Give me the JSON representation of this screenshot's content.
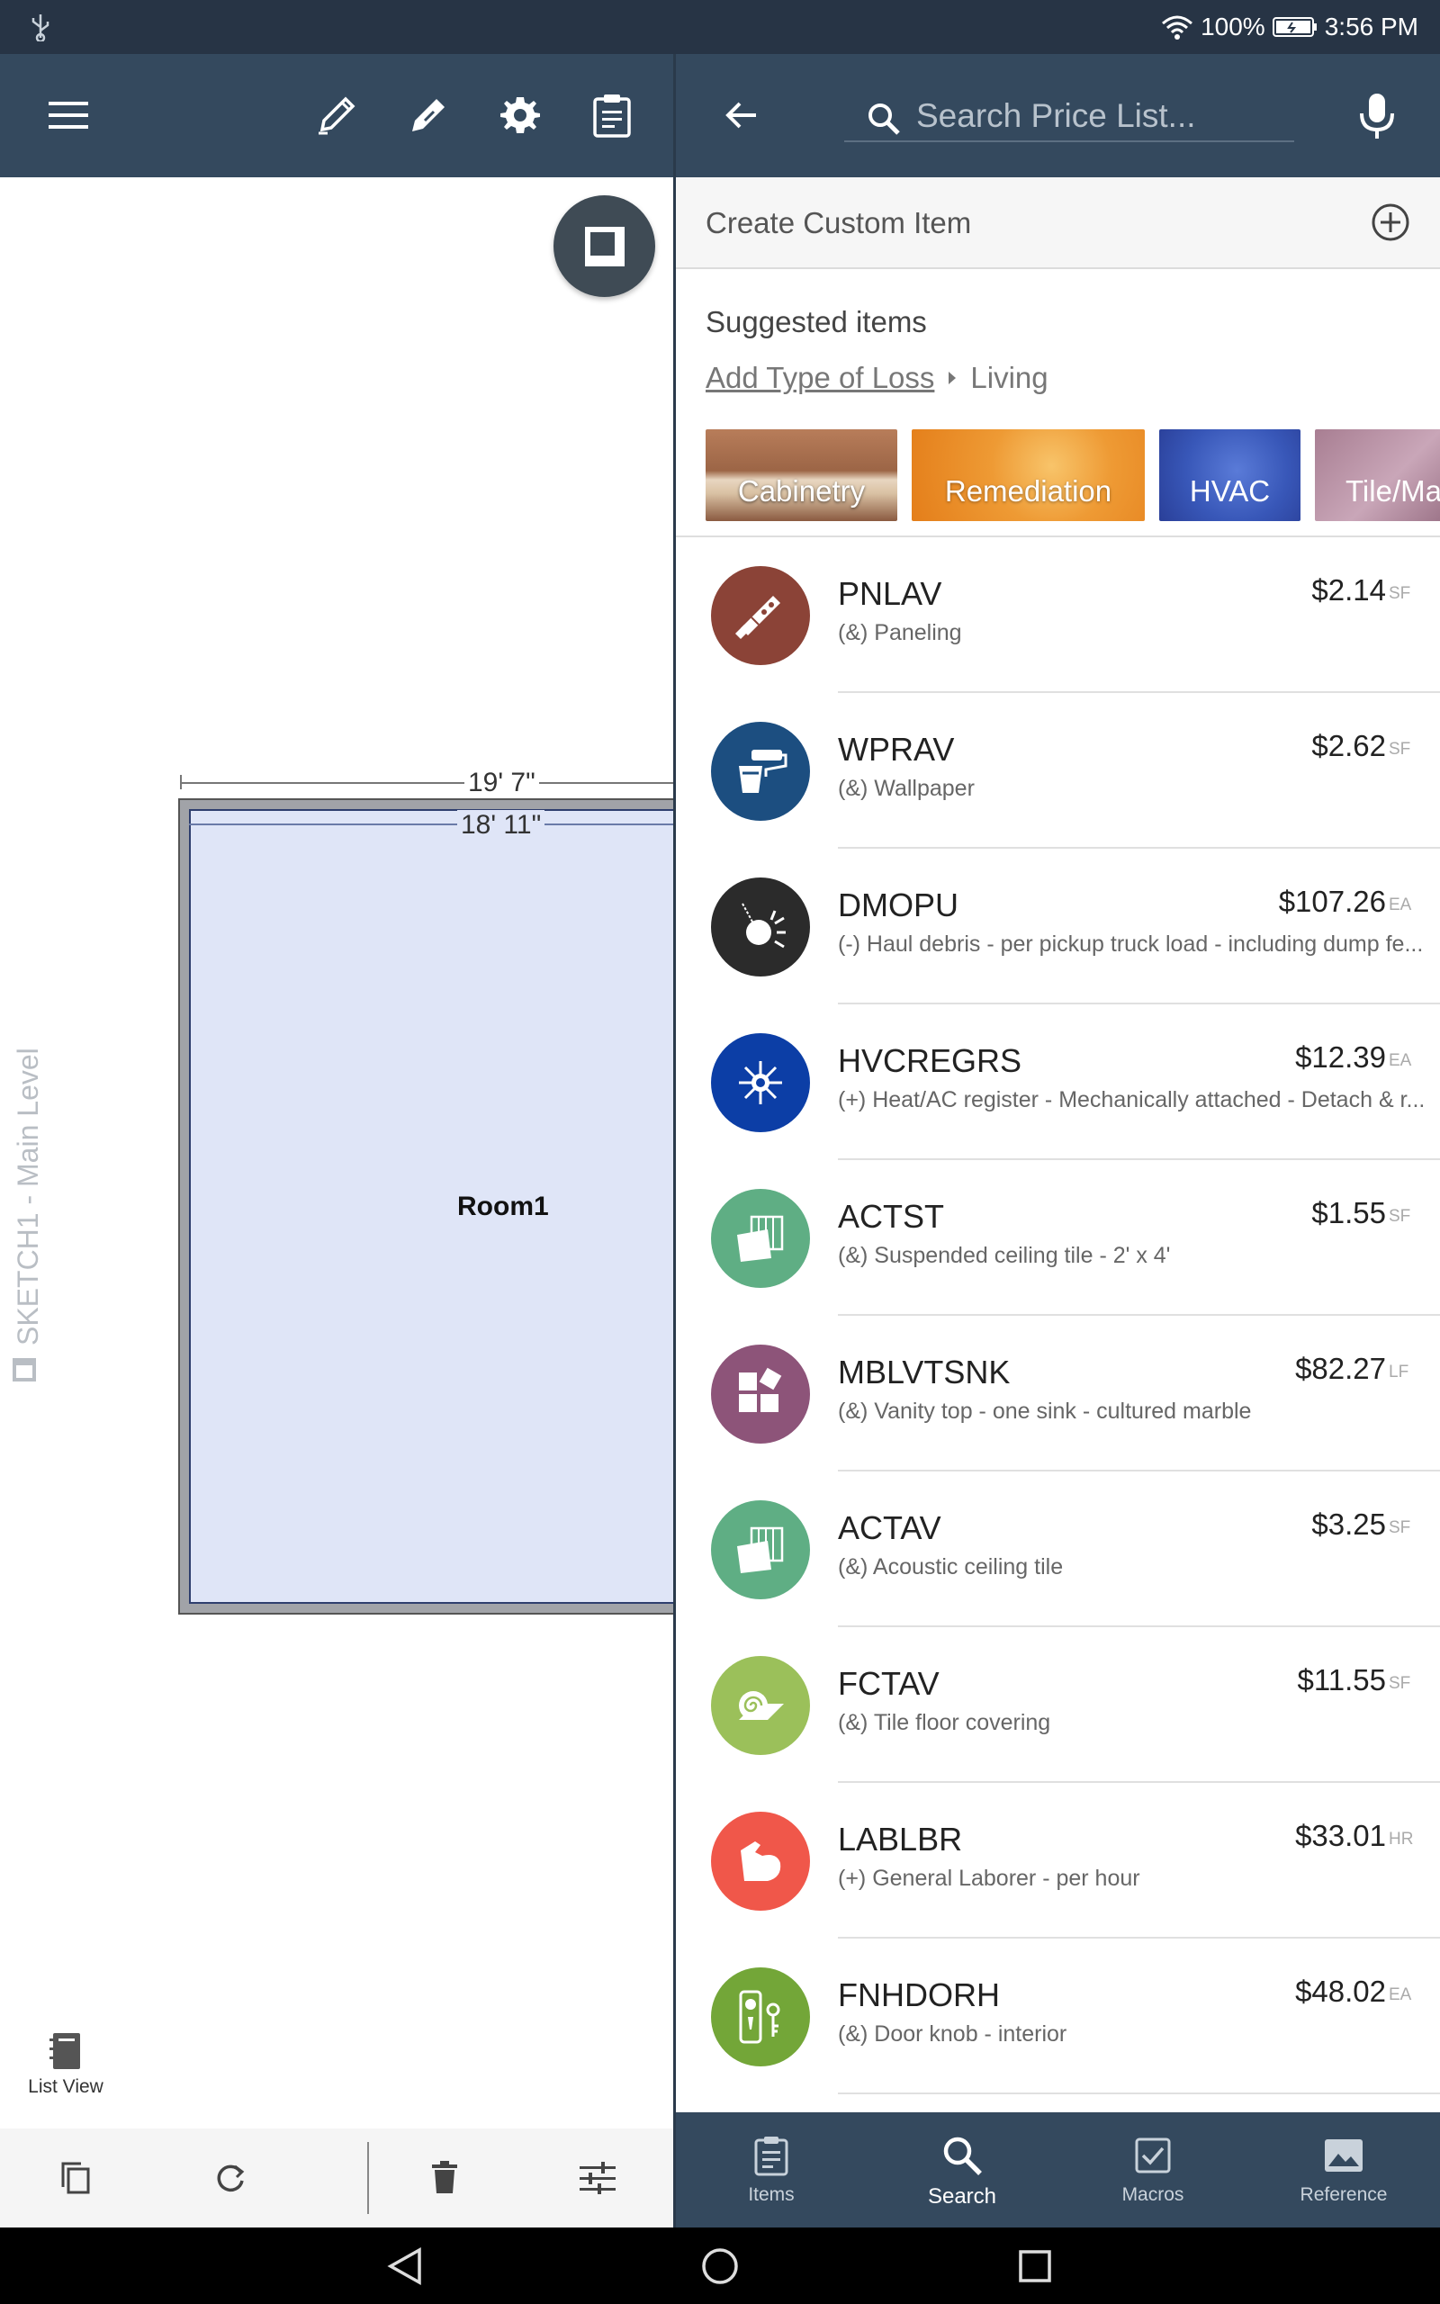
{
  "status_bar": {
    "battery": "100%",
    "time": "3:56 PM"
  },
  "search": {
    "placeholder": "Search Price List..."
  },
  "panel": {
    "create_custom": "Create Custom Item",
    "suggested_heading": "Suggested items",
    "breadcrumb_link": "Add Type of Loss",
    "breadcrumb_current": "Living",
    "categories": [
      "Cabinetry",
      "Remediation",
      "HVAC",
      "Tile/Ma"
    ]
  },
  "items": [
    {
      "code": "PNLAV",
      "desc": "(&) Paneling",
      "price": "$2.14",
      "unit": "SF",
      "color": "#8b4337",
      "icon": "saw-icon"
    },
    {
      "code": "WPRAV",
      "desc": "(&) Wallpaper",
      "price": "$2.62",
      "unit": "SF",
      "color": "#1c4e80",
      "icon": "paint-roller-icon"
    },
    {
      "code": "DMOPU",
      "desc": "(-) Haul debris - per pickup truck load - including dump fe...",
      "price": "$107.26",
      "unit": "EA",
      "color": "#2b2b2b",
      "icon": "wrecking-ball-icon"
    },
    {
      "code": "HVCREGRS",
      "desc": "(+) Heat/AC register - Mechanically attached - Detach & r...",
      "price": "$12.39",
      "unit": "EA",
      "color": "#0c3ea6",
      "icon": "sun-snowflake-icon"
    },
    {
      "code": "ACTST",
      "desc": "(&) Suspended ceiling tile - 2' x 4'",
      "price": "$1.55",
      "unit": "SF",
      "color": "#5fae84",
      "icon": "ceiling-tile-icon"
    },
    {
      "code": "MBLVTSNK",
      "desc": "(&) Vanity top - one sink - cultured marble",
      "price": "$82.27",
      "unit": "LF",
      "color": "#8d5479",
      "icon": "tiles-icon"
    },
    {
      "code": "ACTAV",
      "desc": "(&) Acoustic ceiling tile",
      "price": "$3.25",
      "unit": "SF",
      "color": "#5fae84",
      "icon": "ceiling-tile-icon"
    },
    {
      "code": "FCTAV",
      "desc": "(&) Tile floor covering",
      "price": "$11.55",
      "unit": "SF",
      "color": "#9bc05a",
      "icon": "carpet-roll-icon"
    },
    {
      "code": "LABLBR",
      "desc": "(+) General Laborer - per hour",
      "price": "$33.01",
      "unit": "HR",
      "color": "#f0574a",
      "icon": "flexed-arm-icon"
    },
    {
      "code": "FNHDORH",
      "desc": "(&) Door knob - interior",
      "price": "$48.02",
      "unit": "EA",
      "color": "#73a638",
      "icon": "door-knob-icon"
    }
  ],
  "sketch": {
    "level_label": "SKETCH1 - Main Level",
    "room_name": "Room1",
    "outer_dim": "19' 7\"",
    "inner_dim": "18' 11\"",
    "list_view": "List View"
  },
  "bottom_nav": {
    "items": "Items",
    "search": "Search",
    "macros": "Macros",
    "reference": "Reference"
  }
}
